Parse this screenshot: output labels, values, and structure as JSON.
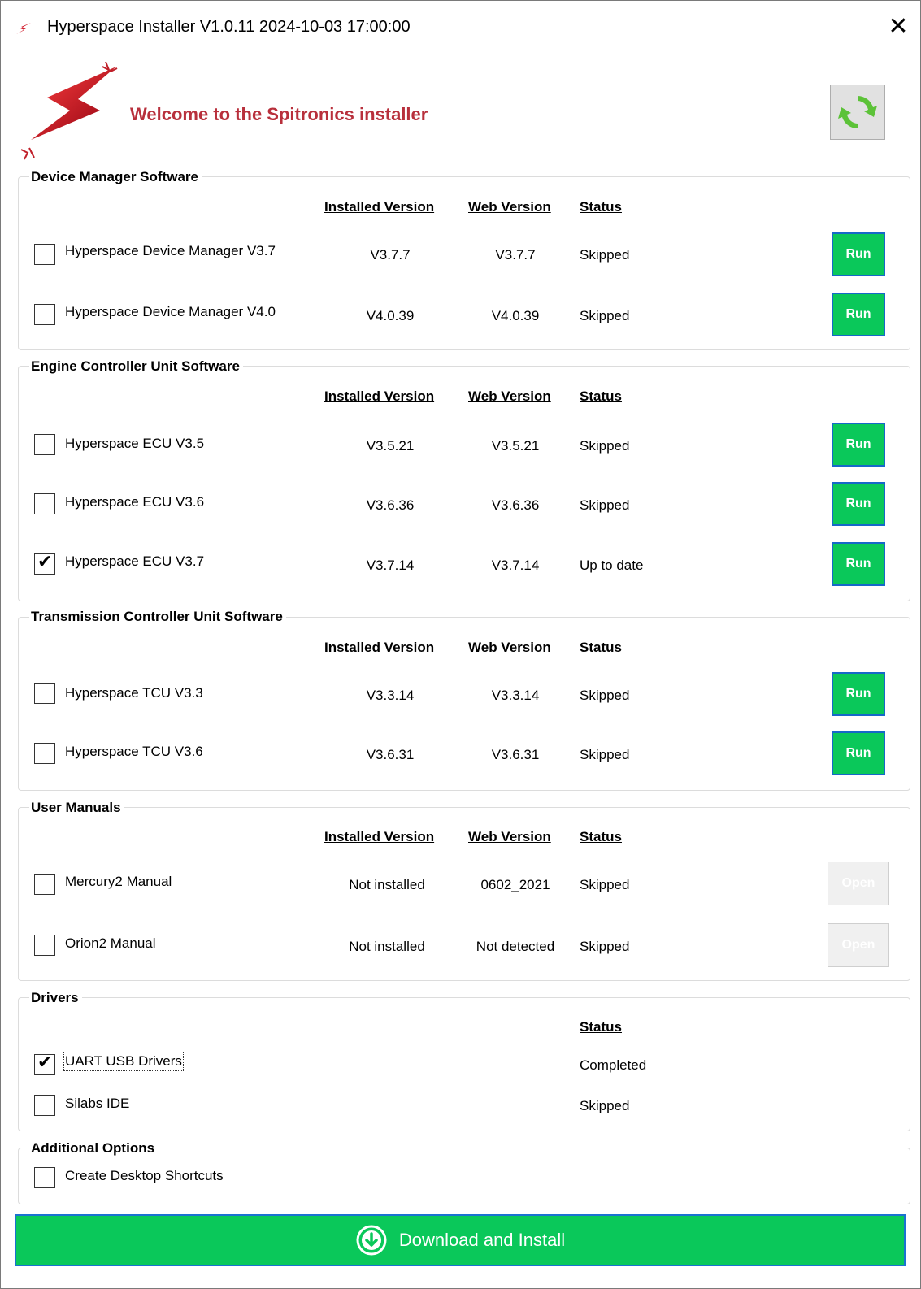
{
  "window": {
    "title": "Hyperspace Installer V1.0.11 2024-10-03 17:00:00",
    "close_glyph": "✕"
  },
  "header": {
    "welcome": "Welcome to the Spitronics installer",
    "refresh_icon": "refresh-icon"
  },
  "columns": {
    "installed": "Installed Version",
    "web": "Web Version",
    "status": "Status"
  },
  "device_manager": {
    "title": "Device Manager Software",
    "items": [
      {
        "label": "Hyperspace Device Manager V3.7",
        "installed": "V3.7.7",
        "web": "V3.7.7",
        "status": "Skipped",
        "checked": false,
        "button": "Run"
      },
      {
        "label": "Hyperspace Device Manager V4.0",
        "installed": "V4.0.39",
        "web": "V4.0.39",
        "status": "Skipped",
        "checked": false,
        "button": "Run"
      }
    ]
  },
  "ecu": {
    "title": "Engine Controller Unit Software",
    "items": [
      {
        "label": "Hyperspace ECU V3.5",
        "installed": "V3.5.21",
        "web": "V3.5.21",
        "status": "Skipped",
        "checked": false,
        "button": "Run"
      },
      {
        "label": "Hyperspace ECU V3.6",
        "installed": "V3.6.36",
        "web": "V3.6.36",
        "status": "Skipped",
        "checked": false,
        "button": "Run"
      },
      {
        "label": "Hyperspace ECU V3.7",
        "installed": "V3.7.14",
        "web": "V3.7.14",
        "status": "Up to date",
        "checked": true,
        "button": "Run"
      }
    ]
  },
  "tcu": {
    "title": "Transmission Controller Unit Software",
    "items": [
      {
        "label": "Hyperspace TCU V3.3",
        "installed": "V3.3.14",
        "web": "V3.3.14",
        "status": "Skipped",
        "checked": false,
        "button": "Run"
      },
      {
        "label": "Hyperspace TCU V3.6",
        "installed": "V3.6.31",
        "web": "V3.6.31",
        "status": "Skipped",
        "checked": false,
        "button": "Run"
      }
    ]
  },
  "manuals": {
    "title": "User Manuals",
    "items": [
      {
        "label": "Mercury2 Manual",
        "installed": "Not installed",
        "web": "0602_2021",
        "status": "Skipped",
        "checked": false,
        "button": "Open"
      },
      {
        "label": "Orion2 Manual",
        "installed": "Not installed",
        "web": "Not detected",
        "status": "Skipped",
        "checked": false,
        "button": "Open"
      }
    ]
  },
  "drivers": {
    "title": "Drivers",
    "items": [
      {
        "label": "UART USB Drivers",
        "status": "Completed",
        "checked": true
      },
      {
        "label": "Silabs IDE",
        "status": "Skipped",
        "checked": false
      }
    ]
  },
  "additional": {
    "title": "Additional Options",
    "items": [
      {
        "label": "Create Desktop Shortcuts",
        "checked": false
      }
    ]
  },
  "download_button": "Download and Install",
  "colors": {
    "accent_green": "#0ac85a",
    "welcome_red": "#b8303c",
    "button_border_blue": "#1668c9"
  }
}
